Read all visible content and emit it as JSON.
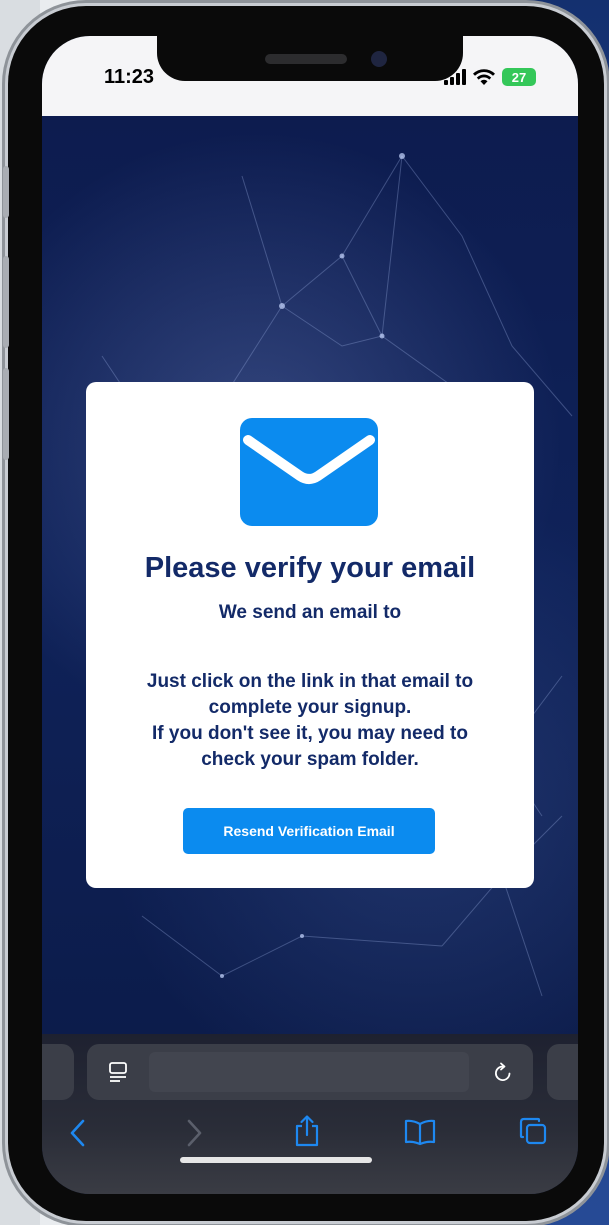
{
  "status_bar": {
    "time": "11:23",
    "battery": "27"
  },
  "card": {
    "title": "Please verify your email",
    "subtitle": "We send an email to",
    "body_lines": [
      "Just click on the link in that email to",
      "complete your signup.",
      "If you don't see it, you may need to",
      "check your spam folder."
    ],
    "resend_button": "Resend Verification Email"
  },
  "browser_toolbar": {
    "icons": [
      "reader-icon",
      "reload-icon",
      "back-icon",
      "forward-icon",
      "share-icon",
      "bookmarks-icon",
      "tabs-icon"
    ]
  },
  "colors": {
    "accent": "#0b8bef",
    "text": "#132a68",
    "background": "#0d1c4f"
  }
}
